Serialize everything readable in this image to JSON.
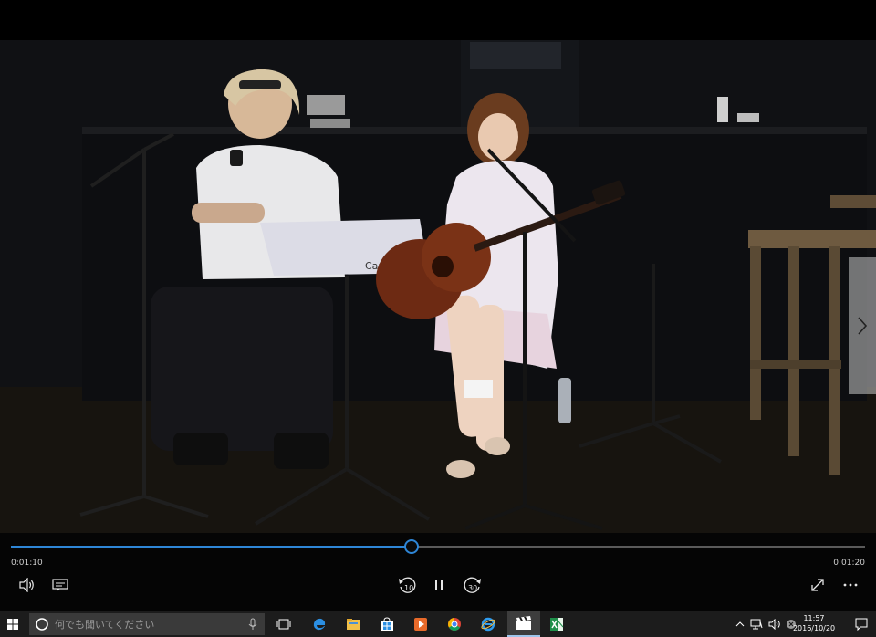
{
  "player": {
    "current_time": "0:01:10",
    "total_time": "0:01:20",
    "progress": 0.469,
    "skip_back_label": "10",
    "skip_forward_label": "30",
    "accent_color": "#2e86d6"
  },
  "video": {
    "music_stand_text": "Campus"
  },
  "icons": {
    "volume": "volume-icon",
    "subtitles": "subtitles-icon",
    "skip_back": "skip-back-icon",
    "pause": "pause-icon",
    "skip_forward": "skip-forward-icon",
    "fullscreen": "fullscreen-icon",
    "more": "more-icon",
    "next": "chevron-right-icon"
  },
  "taskbar": {
    "search_placeholder": "何でも聞いてください",
    "time": "11:57",
    "date": "2016/10/20",
    "apps": [
      "edge",
      "file-explorer",
      "store",
      "media-player",
      "chrome",
      "internet-explorer",
      "movies-tv",
      "excel"
    ],
    "active_app": "movies-tv"
  }
}
